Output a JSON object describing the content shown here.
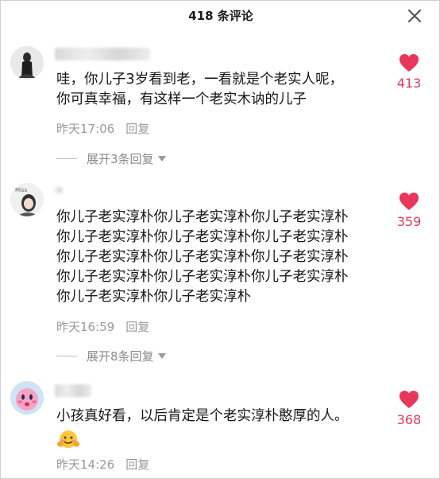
{
  "header": {
    "title": "418 条评论"
  },
  "comments": [
    {
      "text_lines": [
        "哇，你儿子3岁看到老，一看就是个老实人呢，",
        "你可真幸福，有这样一个老实木讷的儿子"
      ],
      "time": "昨天17:06",
      "reply_label": "回复",
      "likes": "413",
      "expand_label": "展开3条回复"
    },
    {
      "text_lines": [
        "你儿子老实淳朴你儿子老实淳朴你儿子老实淳朴",
        "你儿子老实淳朴你儿子老实淳朴你儿子老实淳朴",
        "你儿子老实淳朴你儿子老实淳朴你儿子老实淳朴",
        "你儿子老实淳朴你儿子老实淳朴你儿子老实淳朴",
        "你儿子老实淳朴你儿子老实淳朴"
      ],
      "time": "昨天16:59",
      "reply_label": "回复",
      "likes": "359",
      "expand_label": "展开8条回复"
    },
    {
      "text_lines": [
        "小孩真好看，以后肯定是个老实淳朴憨厚的人。"
      ],
      "time": "昨天14:26",
      "reply_label": "回复",
      "likes": "368",
      "emoji": "hug-emoji"
    }
  ],
  "colors": {
    "like": "#e8375a",
    "meta": "#9a9a9a"
  },
  "icons": {
    "close": "close-icon",
    "like": "heart-icon",
    "expand": "caret-down-icon"
  }
}
